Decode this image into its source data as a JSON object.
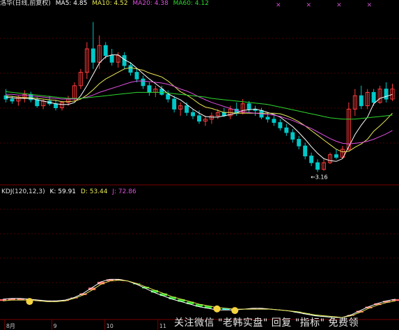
{
  "header": {
    "title": "洛华(日线,前复权)",
    "ma5": "MA5: 4.85",
    "ma10": "MA10: 4.52",
    "ma20": "MA20: 4.38",
    "ma60": "MA60: 4.12"
  },
  "kdj_header": {
    "title": "KDJ(120,12,3)",
    "k": "K: 59.91",
    "d": "D: 53.44",
    "j": "J: 72.86"
  },
  "low_marker": "3.16",
  "date_axis": [
    "8月",
    "9",
    "10",
    "11"
  ],
  "watermark": "关注微信 \"老韩实盘\" 回复 \"指标\" 免费领",
  "colors": {
    "background": "#000000",
    "up": "#ff3c3c",
    "down": "#00c8c8",
    "ma5": "#ffffff",
    "ma10": "#e8e858",
    "ma20": "#e050e0",
    "ma60": "#2ed82e",
    "kdj_title": "#e0e0e0",
    "kdj_k": "#ffffff",
    "kdj_d": "#e8e858",
    "kdj_j": "#e050e0"
  },
  "chart_data": [
    {
      "type": "candlestick",
      "series": [
        {
          "name": "K线",
          "values": [
            {
              "o": 4.3,
              "h": 4.4,
              "l": 4.2,
              "c": 4.25
            },
            {
              "o": 4.25,
              "h": 4.3,
              "l": 4.18,
              "c": 4.22
            },
            {
              "o": 4.22,
              "h": 4.3,
              "l": 4.15,
              "c": 4.28
            },
            {
              "o": 4.28,
              "h": 4.38,
              "l": 4.2,
              "c": 4.32
            },
            {
              "o": 4.32,
              "h": 4.36,
              "l": 4.2,
              "c": 4.24
            },
            {
              "o": 4.24,
              "h": 4.28,
              "l": 4.12,
              "c": 4.15
            },
            {
              "o": 4.15,
              "h": 4.25,
              "l": 4.1,
              "c": 4.22
            },
            {
              "o": 4.22,
              "h": 4.3,
              "l": 4.15,
              "c": 4.18
            },
            {
              "o": 4.18,
              "h": 4.24,
              "l": 4.08,
              "c": 4.12
            },
            {
              "o": 4.12,
              "h": 4.22,
              "l": 4.08,
              "c": 4.2
            },
            {
              "o": 4.2,
              "h": 4.3,
              "l": 4.15,
              "c": 4.25
            },
            {
              "o": 4.25,
              "h": 4.5,
              "l": 4.22,
              "c": 4.45
            },
            {
              "o": 4.45,
              "h": 4.7,
              "l": 4.4,
              "c": 4.65
            },
            {
              "o": 4.65,
              "h": 5.1,
              "l": 4.55,
              "c": 5.0
            },
            {
              "o": 5.0,
              "h": 5.4,
              "l": 4.7,
              "c": 4.8
            },
            {
              "o": 4.8,
              "h": 5.2,
              "l": 4.7,
              "c": 5.05
            },
            {
              "o": 5.05,
              "h": 5.1,
              "l": 4.85,
              "c": 4.9
            },
            {
              "o": 4.9,
              "h": 5.0,
              "l": 4.75,
              "c": 4.8
            },
            {
              "o": 4.8,
              "h": 4.95,
              "l": 4.72,
              "c": 4.9
            },
            {
              "o": 4.9,
              "h": 4.95,
              "l": 4.7,
              "c": 4.75
            },
            {
              "o": 4.75,
              "h": 4.8,
              "l": 4.6,
              "c": 4.65
            },
            {
              "o": 4.65,
              "h": 4.7,
              "l": 4.5,
              "c": 4.55
            },
            {
              "o": 4.55,
              "h": 4.6,
              "l": 4.4,
              "c": 4.45
            },
            {
              "o": 4.45,
              "h": 4.5,
              "l": 4.3,
              "c": 4.35
            },
            {
              "o": 4.35,
              "h": 4.45,
              "l": 4.28,
              "c": 4.4
            },
            {
              "o": 4.4,
              "h": 4.45,
              "l": 4.3,
              "c": 4.32
            },
            {
              "o": 4.32,
              "h": 4.38,
              "l": 4.2,
              "c": 4.25
            },
            {
              "o": 4.25,
              "h": 4.3,
              "l": 4.05,
              "c": 4.1
            },
            {
              "o": 4.1,
              "h": 4.2,
              "l": 4.0,
              "c": 4.15
            },
            {
              "o": 4.15,
              "h": 4.2,
              "l": 4.0,
              "c": 4.05
            },
            {
              "o": 4.05,
              "h": 4.1,
              "l": 3.95,
              "c": 4.0
            },
            {
              "o": 4.0,
              "h": 4.08,
              "l": 3.88,
              "c": 3.92
            },
            {
              "o": 3.92,
              "h": 4.0,
              "l": 3.85,
              "c": 3.95
            },
            {
              "o": 3.95,
              "h": 4.05,
              "l": 3.88,
              "c": 4.0
            },
            {
              "o": 4.0,
              "h": 4.1,
              "l": 3.95,
              "c": 4.05
            },
            {
              "o": 4.05,
              "h": 4.12,
              "l": 3.98,
              "c": 4.0
            },
            {
              "o": 4.0,
              "h": 4.15,
              "l": 3.95,
              "c": 4.1
            },
            {
              "o": 4.1,
              "h": 4.2,
              "l": 4.0,
              "c": 4.05
            },
            {
              "o": 4.05,
              "h": 4.25,
              "l": 4.02,
              "c": 4.18
            },
            {
              "o": 4.18,
              "h": 4.22,
              "l": 4.05,
              "c": 4.1
            },
            {
              "o": 4.1,
              "h": 4.15,
              "l": 4.0,
              "c": 4.08
            },
            {
              "o": 4.08,
              "h": 4.12,
              "l": 3.95,
              "c": 3.98
            },
            {
              "o": 3.98,
              "h": 4.05,
              "l": 3.9,
              "c": 3.95
            },
            {
              "o": 3.95,
              "h": 4.0,
              "l": 3.85,
              "c": 3.9
            },
            {
              "o": 3.9,
              "h": 3.95,
              "l": 3.78,
              "c": 3.82
            },
            {
              "o": 3.82,
              "h": 3.88,
              "l": 3.7,
              "c": 3.75
            },
            {
              "o": 3.75,
              "h": 3.8,
              "l": 3.6,
              "c": 3.65
            },
            {
              "o": 3.65,
              "h": 3.7,
              "l": 3.5,
              "c": 3.55
            },
            {
              "o": 3.55,
              "h": 3.6,
              "l": 3.35,
              "c": 3.4
            },
            {
              "o": 3.4,
              "h": 3.45,
              "l": 3.25,
              "c": 3.3
            },
            {
              "o": 3.3,
              "h": 3.35,
              "l": 3.16,
              "c": 3.2
            },
            {
              "o": 3.2,
              "h": 3.35,
              "l": 3.18,
              "c": 3.3
            },
            {
              "o": 3.3,
              "h": 3.45,
              "l": 3.28,
              "c": 3.42
            },
            {
              "o": 3.42,
              "h": 3.5,
              "l": 3.35,
              "c": 3.38
            },
            {
              "o": 3.38,
              "h": 3.55,
              "l": 3.36,
              "c": 3.5
            },
            {
              "o": 3.5,
              "h": 4.2,
              "l": 3.48,
              "c": 4.1
            },
            {
              "o": 4.1,
              "h": 4.4,
              "l": 4.0,
              "c": 4.3
            },
            {
              "o": 4.3,
              "h": 4.45,
              "l": 4.1,
              "c": 4.15
            },
            {
              "o": 4.15,
              "h": 4.4,
              "l": 4.1,
              "c": 4.35
            },
            {
              "o": 4.35,
              "h": 4.4,
              "l": 4.15,
              "c": 4.2
            },
            {
              "o": 4.2,
              "h": 4.45,
              "l": 4.18,
              "c": 4.4
            },
            {
              "o": 4.4,
              "h": 4.5,
              "l": 4.2,
              "c": 4.25
            },
            {
              "o": 4.25,
              "h": 4.48,
              "l": 4.22,
              "c": 4.4
            }
          ]
        }
      ],
      "ma_series": [
        {
          "name": "MA5",
          "values": [
            4.28,
            4.27,
            4.26,
            4.26,
            4.26,
            4.24,
            4.22,
            4.2,
            4.18,
            4.17,
            4.17,
            4.2,
            4.3,
            4.45,
            4.62,
            4.79,
            4.88,
            4.91,
            4.91,
            4.84,
            4.79,
            4.71,
            4.63,
            4.55,
            4.48,
            4.41,
            4.33,
            4.28,
            4.24,
            4.17,
            4.1,
            4.04,
            3.99,
            3.98,
            3.98,
            4.0,
            4.02,
            4.04,
            4.08,
            4.09,
            4.1,
            4.08,
            4.05,
            4.02,
            3.98,
            3.91,
            3.84,
            3.75,
            3.65,
            3.54,
            3.44,
            3.36,
            3.33,
            3.32,
            3.36,
            3.54,
            3.72,
            3.86,
            3.98,
            4.18,
            4.26,
            4.29,
            4.32
          ]
        },
        {
          "name": "MA10",
          "values": [
            4.3,
            4.29,
            4.28,
            4.27,
            4.27,
            4.26,
            4.25,
            4.24,
            4.23,
            4.21,
            4.21,
            4.22,
            4.25,
            4.31,
            4.39,
            4.48,
            4.55,
            4.6,
            4.65,
            4.7,
            4.72,
            4.7,
            4.68,
            4.64,
            4.61,
            4.58,
            4.52,
            4.44,
            4.36,
            4.31,
            4.25,
            4.18,
            4.13,
            4.11,
            4.08,
            4.05,
            4.05,
            4.04,
            4.04,
            4.04,
            4.04,
            4.04,
            4.04,
            4.04,
            4.03,
            4.0,
            3.96,
            3.91,
            3.85,
            3.78,
            3.71,
            3.64,
            3.57,
            3.5,
            3.46,
            3.47,
            3.53,
            3.58,
            3.65,
            3.77,
            3.85,
            3.94,
            4.04
          ]
        },
        {
          "name": "MA20",
          "values": [
            4.32,
            4.32,
            4.31,
            4.31,
            4.3,
            4.29,
            4.28,
            4.27,
            4.26,
            4.25,
            4.25,
            4.25,
            4.26,
            4.28,
            4.31,
            4.35,
            4.38,
            4.41,
            4.44,
            4.47,
            4.5,
            4.52,
            4.52,
            4.51,
            4.5,
            4.49,
            4.47,
            4.44,
            4.4,
            4.37,
            4.33,
            4.28,
            4.24,
            4.2,
            4.17,
            4.14,
            4.11,
            4.08,
            4.06,
            4.05,
            4.04,
            4.03,
            4.02,
            4.01,
            3.99,
            3.96,
            3.93,
            3.89,
            3.85,
            3.81,
            3.76,
            3.71,
            3.66,
            3.62,
            3.59,
            3.58,
            3.59,
            3.6,
            3.62,
            3.65,
            3.69,
            3.73,
            3.78
          ]
        },
        {
          "name": "MA60",
          "values": [
            4.36,
            4.35,
            4.34,
            4.33,
            4.32,
            4.31,
            4.3,
            4.29,
            4.28,
            4.27,
            4.26,
            4.26,
            4.26,
            4.27,
            4.28,
            4.29,
            4.3,
            4.31,
            4.32,
            4.33,
            4.34,
            4.35,
            4.35,
            4.35,
            4.35,
            4.35,
            4.34,
            4.33,
            4.32,
            4.31,
            4.3,
            4.29,
            4.28,
            4.26,
            4.25,
            4.24,
            4.23,
            4.22,
            4.21,
            4.2,
            4.19,
            4.18,
            4.17,
            4.15,
            4.13,
            4.11,
            4.09,
            4.07,
            4.05,
            4.03,
            4.01,
            3.99,
            3.97,
            3.96,
            3.95,
            3.95,
            3.95,
            3.96,
            3.97,
            3.98,
            3.99,
            4.0,
            4.01
          ]
        }
      ],
      "ylim": [
        3.0,
        5.5
      ]
    },
    {
      "type": "area",
      "series": [
        {
          "name": "K",
          "values": [
            22,
            23,
            23,
            22,
            21,
            20,
            20,
            21,
            24,
            29,
            36,
            43,
            46,
            46,
            44,
            40,
            35,
            30,
            26,
            22,
            19,
            16,
            13,
            11,
            9,
            9,
            9,
            10,
            11,
            11,
            10,
            9,
            8,
            6,
            4,
            2,
            1,
            0,
            0,
            3,
            8,
            13,
            17,
            20,
            22
          ]
        },
        {
          "name": "D",
          "values": [
            20,
            21,
            21,
            21,
            20,
            19,
            19,
            20,
            23,
            27,
            33,
            40,
            44,
            45,
            44,
            41,
            37,
            33,
            29,
            25,
            22,
            19,
            16,
            14,
            12,
            11,
            10,
            10,
            10,
            10,
            10,
            9,
            8,
            7,
            5,
            3,
            2,
            1,
            0,
            2,
            6,
            11,
            15,
            18,
            20
          ]
        }
      ],
      "ylim": [
        0,
        80
      ]
    }
  ]
}
